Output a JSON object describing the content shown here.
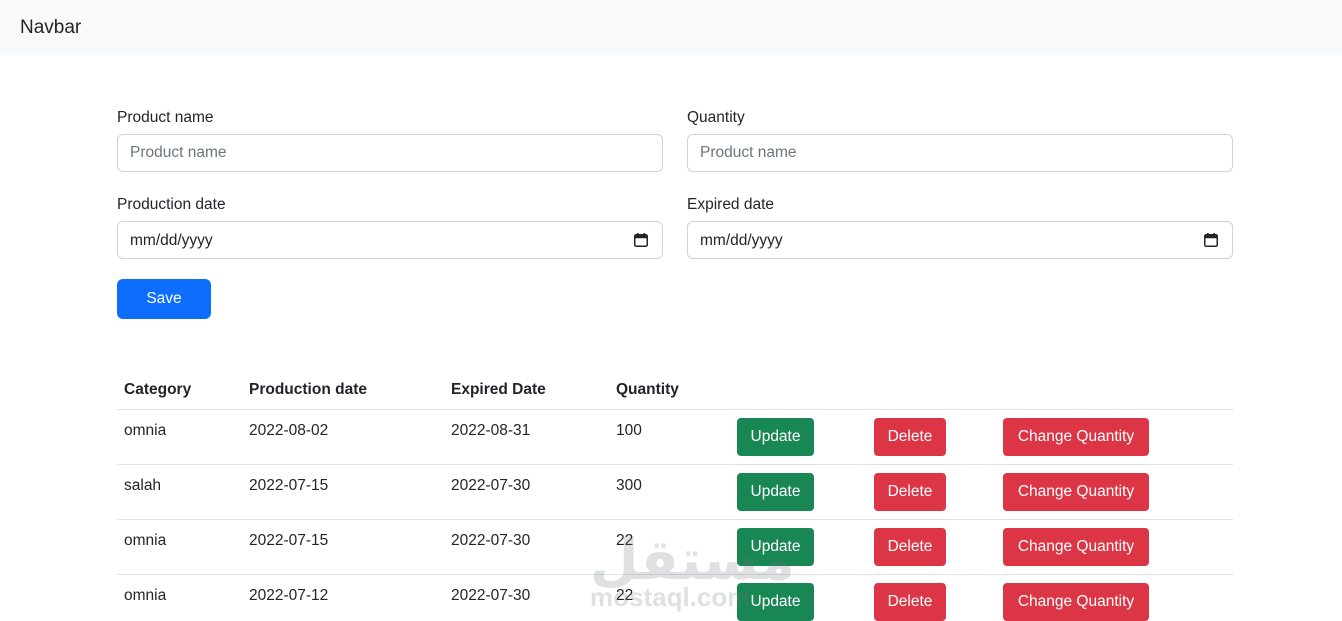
{
  "navbar": {
    "brand": "Navbar"
  },
  "form": {
    "product_name": {
      "label": "Product name",
      "placeholder": "Product name"
    },
    "quantity": {
      "label": "Quantity",
      "placeholder": "Product name"
    },
    "production_date": {
      "label": "Production date",
      "value": "mm/dd/yyyy"
    },
    "expired_date": {
      "label": "Expired date",
      "value": "mm/dd/yyyy"
    },
    "save_label": "Save"
  },
  "table": {
    "headers": [
      "Category",
      "Production date",
      "Expired Date",
      "Quantity"
    ],
    "rows": [
      {
        "category": "omnia",
        "production_date": "2022-08-02",
        "expired_date": "2022-08-31",
        "quantity": "100"
      },
      {
        "category": "salah",
        "production_date": "2022-07-15",
        "expired_date": "2022-07-30",
        "quantity": "300"
      },
      {
        "category": "omnia",
        "production_date": "2022-07-15",
        "expired_date": "2022-07-30",
        "quantity": "22"
      },
      {
        "category": "omnia",
        "production_date": "2022-07-12",
        "expired_date": "2022-07-30",
        "quantity": "22"
      }
    ],
    "actions": {
      "update_label": "Update",
      "delete_label": "Delete",
      "change_quantity_label": "Change Quantity"
    }
  },
  "watermark": {
    "arabic": "مستقل",
    "latin": "mostaql.com"
  },
  "colors": {
    "primary": "#0d6efd",
    "success": "#198754",
    "danger": "#dc3545",
    "navbar_bg": "#f8f9fa"
  },
  "icons": {
    "date_picker": "calendar-icon"
  }
}
